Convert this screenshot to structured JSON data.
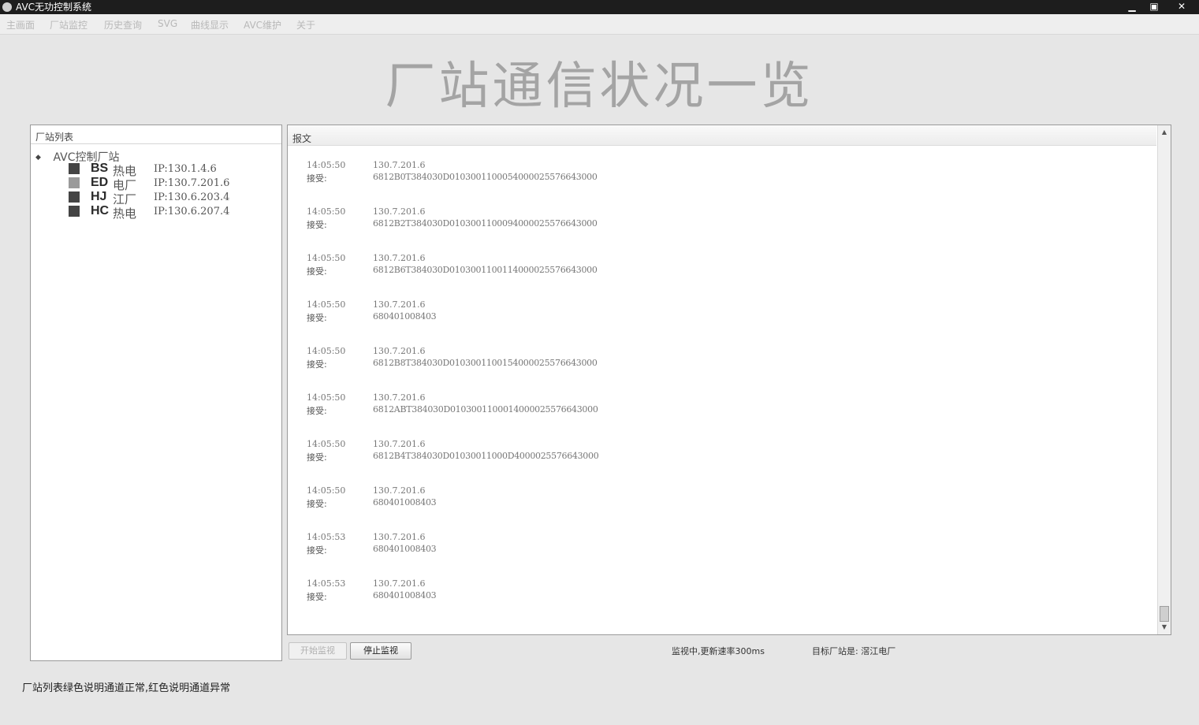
{
  "window": {
    "title": "AVC无功控制系统",
    "controls": {
      "minimize": "▁",
      "maximize": "▣",
      "close": "✕"
    }
  },
  "menu": {
    "items": [
      {
        "label": "主画面"
      },
      {
        "label": "厂站监控"
      },
      {
        "label": "历史查询"
      },
      {
        "label": "SVG"
      },
      {
        "label": "曲线显示"
      },
      {
        "label": "AVC维护"
      },
      {
        "label": "关于"
      }
    ]
  },
  "page_title": "厂站通信状况一览",
  "station_panel": {
    "header": "厂站列表",
    "root": {
      "expander": "◆",
      "label": "AVC控制厂站"
    },
    "stations": [
      {
        "code": "BS",
        "name": "热电",
        "ip": "IP:130.1.4.6",
        "status_color": "#444444"
      },
      {
        "code": "ED",
        "name": "电厂",
        "ip": "IP:130.7.201.6",
        "status_color": "#9a9a9a"
      },
      {
        "code": "HJ",
        "name": "江厂",
        "ip": "IP:130.6.203.4",
        "status_color": "#444444"
      },
      {
        "code": "HC",
        "name": "热电",
        "ip": "IP:130.6.207.4",
        "status_color": "#444444"
      }
    ]
  },
  "log_panel": {
    "header": "报文",
    "scroll": {
      "up": "▲",
      "down": "▼"
    },
    "entries": [
      {
        "time": "14:05:50",
        "ip": "130.7.201.6",
        "direction": "接受:",
        "message": "6812B0T384030D0103001100054000025576643000"
      },
      {
        "time": "14:05:50",
        "ip": "130.7.201.6",
        "direction": "接受:",
        "message": "6812B2T384030D0103001100094000025576643000"
      },
      {
        "time": "14:05:50",
        "ip": "130.7.201.6",
        "direction": "接受:",
        "message": "6812B6T384030D0103001100114000025576643000"
      },
      {
        "time": "14:05:50",
        "ip": "130.7.201.6",
        "direction": "接受:",
        "message": "680401008403"
      },
      {
        "time": "14:05:50",
        "ip": "130.7.201.6",
        "direction": "接受:",
        "message": "6812B8T384030D0103001100154000025576643000"
      },
      {
        "time": "14:05:50",
        "ip": "130.7.201.6",
        "direction": "接受:",
        "message": "6812ABT384030D0103001100014000025576643000"
      },
      {
        "time": "14:05:50",
        "ip": "130.7.201.6",
        "direction": "接受:",
        "message": "6812B4T384030D01030011000D4000025576643000"
      },
      {
        "time": "14:05:50",
        "ip": "130.7.201.6",
        "direction": "接受:",
        "message": "680401008403"
      },
      {
        "time": "14:05:53",
        "ip": "130.7.201.6",
        "direction": "接受:",
        "message": "680401008403"
      },
      {
        "time": "14:05:53",
        "ip": "130.7.201.6",
        "direction": "接受:",
        "message": "680401008403"
      }
    ]
  },
  "controls": {
    "start_label": "开始监视",
    "stop_label": "停止监视"
  },
  "status": {
    "monitoring": "监视中,更新速率300ms",
    "target": "目标厂站是: 滘江电厂"
  },
  "legend_note": "厂站列表绿色说明通道正常,红色说明通道异常"
}
